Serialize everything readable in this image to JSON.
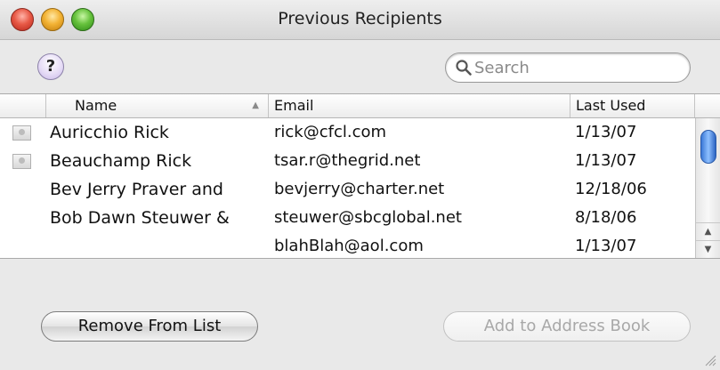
{
  "window": {
    "title": "Previous Recipients"
  },
  "toolbar": {
    "help_label": "?",
    "search_placeholder": "Search"
  },
  "table": {
    "columns": {
      "name": "Name",
      "email": "Email",
      "last_used": "Last Used"
    },
    "sorted_by": "Name",
    "rows": [
      {
        "has_icon": true,
        "name": "Auricchio Rick",
        "email": "rick@cfcl.com",
        "last_used": "1/13/07"
      },
      {
        "has_icon": true,
        "name": "Beauchamp Rick",
        "email": "tsar.r@thegrid.net",
        "last_used": "1/13/07"
      },
      {
        "has_icon": false,
        "name": "Bev Jerry Praver and",
        "email": "bevjerry@charter.net",
        "last_used": "12/18/06"
      },
      {
        "has_icon": false,
        "name": "Bob Dawn Steuwer &",
        "email": "steuwer@sbcglobal.net",
        "last_used": "8/18/06"
      },
      {
        "has_icon": false,
        "name": "",
        "email": "blahBlah@aol.com",
        "last_used": "1/13/07"
      }
    ]
  },
  "buttons": {
    "remove_label": "Remove From List",
    "add_label": "Add to Address Book",
    "add_enabled": false
  },
  "colors": {
    "scroll_thumb": "#3a78d6",
    "disabled_text": "#a8a8a8"
  }
}
